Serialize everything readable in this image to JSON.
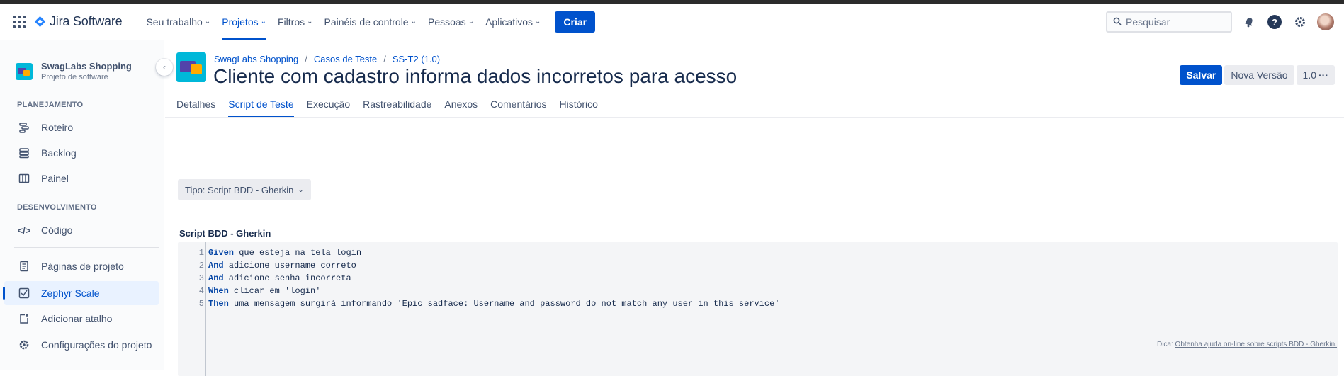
{
  "nav": {
    "logo_text": "Jira Software",
    "menu": [
      {
        "label": "Seu trabalho",
        "active": false
      },
      {
        "label": "Projetos",
        "active": true
      },
      {
        "label": "Filtros",
        "active": false
      },
      {
        "label": "Painéis de controle",
        "active": false
      },
      {
        "label": "Pessoas",
        "active": false
      },
      {
        "label": "Aplicativos",
        "active": false
      }
    ],
    "create_label": "Criar",
    "search_placeholder": "Pesquisar",
    "help_glyph": "?"
  },
  "sidebar": {
    "project_name": "SwagLabs Shopping",
    "project_type": "Projeto de software",
    "sections": {
      "planning": "PLANEJAMENTO",
      "development": "DESENVOLVIMENTO"
    },
    "items": [
      {
        "label": "Roteiro",
        "icon": "roadmap-icon"
      },
      {
        "label": "Backlog",
        "icon": "backlog-icon"
      },
      {
        "label": "Painel",
        "icon": "board-icon"
      },
      {
        "label": "Código",
        "icon": "code-icon"
      },
      {
        "label": "Páginas de projeto",
        "icon": "pages-icon"
      },
      {
        "label": "Zephyr Scale",
        "icon": "zephyr-icon",
        "active": true
      },
      {
        "label": "Adicionar atalho",
        "icon": "add-shortcut-icon"
      },
      {
        "label": "Configurações do projeto",
        "icon": "settings-icon"
      }
    ]
  },
  "header": {
    "breadcrumb": [
      "SwagLabs Shopping",
      "Casos de Teste",
      "SS-T2 (1.0)"
    ],
    "title": "Cliente com cadastro informa dados incorretos para acesso",
    "actions": {
      "save": "Salvar",
      "new_version": "Nova Versão",
      "version": "1.0",
      "more": "···"
    }
  },
  "tabs": [
    {
      "label": "Detalhes",
      "active": false
    },
    {
      "label": "Script de Teste",
      "active": true
    },
    {
      "label": "Execução",
      "active": false
    },
    {
      "label": "Rastreabilidade",
      "active": false
    },
    {
      "label": "Anexos",
      "active": false
    },
    {
      "label": "Comentários",
      "active": false
    },
    {
      "label": "Histórico",
      "active": false
    }
  ],
  "script": {
    "type_selector": "Tipo: Script BDD - Gherkin",
    "title": "Script BDD - Gherkin",
    "lines": [
      {
        "n": "1",
        "kw": "Given",
        "text": " que esteja na tela login"
      },
      {
        "n": "2",
        "kw": "And",
        "text": " adicione username correto"
      },
      {
        "n": "3",
        "kw": "And",
        "text": " adicione senha incorreta"
      },
      {
        "n": "4",
        "kw": "When",
        "text": " clicar em 'login'"
      },
      {
        "n": "5",
        "kw": "Then",
        "text": " uma mensagem surgirá informando 'Epic sadface: Username and password do not match any user in this service'"
      }
    ],
    "tip_label": "Dica:",
    "tip_link": "Obtenha ajuda on-line sobre scripts BDD - Gherkin."
  },
  "colors": {
    "accent": "#0052cc",
    "text": "#172b4d",
    "subtle": "#42526e"
  }
}
